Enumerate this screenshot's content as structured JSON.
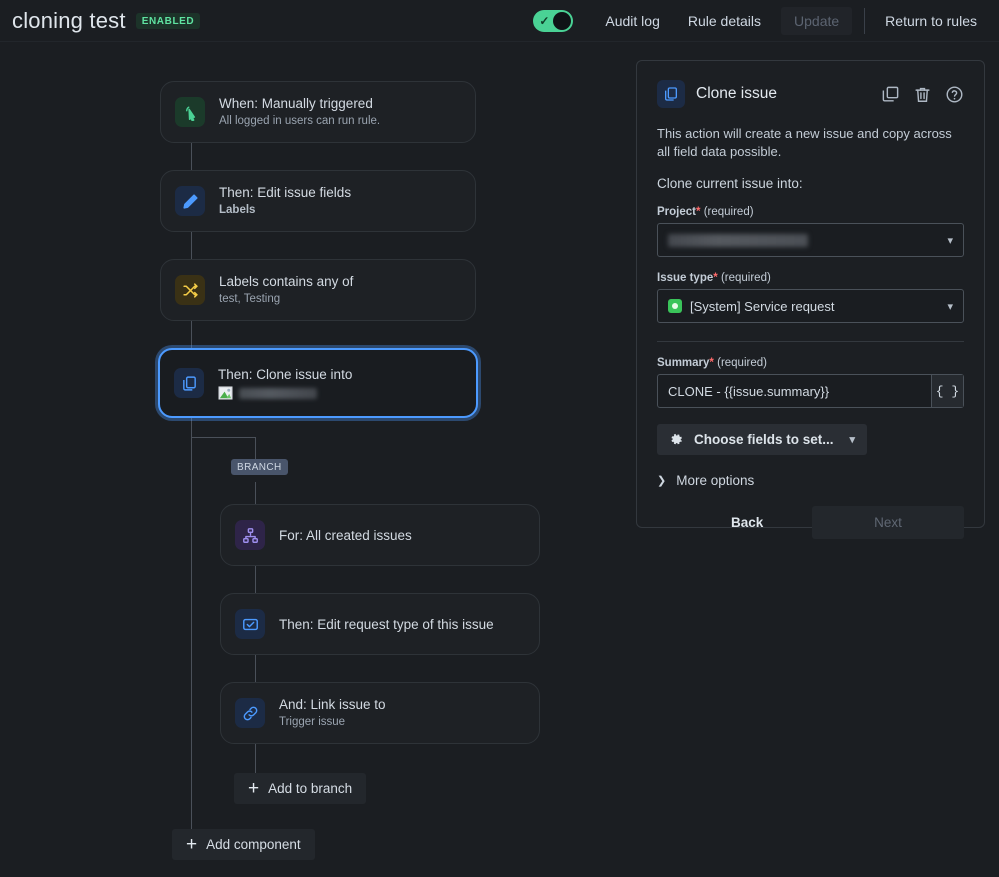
{
  "header": {
    "rule_name": "cloning test",
    "status_badge": "ENABLED",
    "toggle_state": "on",
    "links": [
      {
        "label": "Audit log",
        "name": "audit-log-link"
      },
      {
        "label": "Rule details",
        "name": "rule-details-link"
      }
    ],
    "update_label": "Update",
    "update_disabled": true,
    "return_label": "Return to rules"
  },
  "canvas": {
    "nodes": [
      {
        "title": "When: Manually triggered",
        "subtitle": "All logged in users can run rule.",
        "icon": "cursor-click-icon",
        "icon_bg": "#1b3a2a",
        "icon_color": "#4ad295",
        "selected": false
      },
      {
        "title": "Then: Edit issue fields",
        "subtitle": "Labels",
        "icon": "pencil-icon",
        "icon_bg": "#1c2b45",
        "icon_color": "#4c9aff",
        "selected": false
      },
      {
        "title": "Labels contains any of",
        "subtitle": "test, Testing",
        "icon": "shuffle-icon",
        "icon_bg": "#3a3115",
        "icon_color": "#f5cd47",
        "selected": false
      },
      {
        "title": "Then: Clone issue into",
        "subtitle": "",
        "icon": "copy-issue-icon",
        "icon_bg": "#1c2b45",
        "icon_color": "#4c9aff",
        "selected": true,
        "subtitle_redacted": true,
        "subtitle_icon": "broken-image-icon"
      }
    ],
    "branch_label": "BRANCH",
    "branch_nodes": [
      {
        "title": "For: All created issues",
        "subtitle": "",
        "icon": "branch-tree-icon",
        "icon_bg": "#2e2448",
        "icon_color": "#9f8fef",
        "selected": false
      },
      {
        "title": "Then: Edit request type of this issue",
        "subtitle": "",
        "icon": "request-type-icon",
        "icon_bg": "#1c2b45",
        "icon_color": "#4c9aff",
        "selected": false
      },
      {
        "title": "And: Link issue to",
        "subtitle": "Trigger issue",
        "icon": "link-icon",
        "icon_bg": "#1c2b45",
        "icon_color": "#4c9aff",
        "selected": false
      }
    ],
    "add_to_branch_label": "Add to branch",
    "add_component_label": "Add component"
  },
  "panel": {
    "title": "Clone issue",
    "icon": "copy-issue-icon",
    "actions": [
      {
        "label": "Duplicate",
        "name": "duplicate-icon"
      },
      {
        "label": "Delete",
        "name": "trash-icon"
      },
      {
        "label": "Help",
        "name": "help-icon"
      }
    ],
    "description": "This action will create a new issue and copy across all field data possible.",
    "lead_in": "Clone current issue into:",
    "project_field": {
      "label": "Project",
      "required_marker": "*",
      "required_text": "(required)",
      "value": "",
      "redacted": true
    },
    "issue_type_field": {
      "label": "Issue type",
      "required_marker": "*",
      "required_text": "(required)",
      "value": "[System] Service request"
    },
    "summary_field": {
      "label": "Summary",
      "required_marker": "*",
      "required_text": "(required)",
      "value": "CLONE - {{issue.summary}}",
      "placeholder": "Summary",
      "smart_value_button": "{ }"
    },
    "choose_fields_label": "Choose fields to set...",
    "more_options_label": "More options",
    "back_label": "Back",
    "next_label": "Next",
    "next_disabled": true
  },
  "colors": {
    "page_bg": "#1b1e22",
    "card_bg": "#1e2125",
    "card_border": "#2e3338",
    "accent_blue": "#4c9aff",
    "accent_green": "#4ad295",
    "badge_green_text": "#5fe3a1",
    "badge_green_bg": "#1c3329",
    "required_red": "#ff6b6b"
  }
}
